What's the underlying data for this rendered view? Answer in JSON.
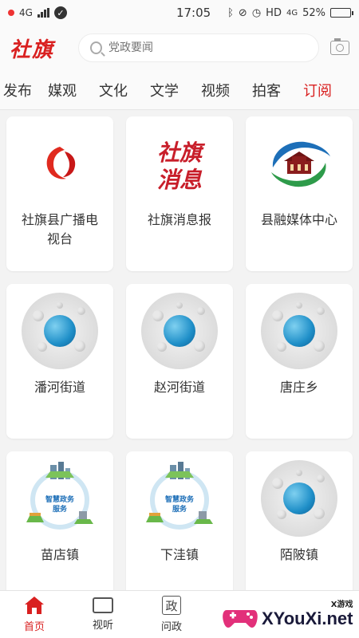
{
  "status_bar": {
    "network": "4G",
    "time": "17:05",
    "network_right": "HD",
    "network_right_type": "4G",
    "battery": "52%",
    "battery_level": 0.52
  },
  "header": {
    "logo_text": "社旗",
    "search_placeholder": "党政要闻",
    "camera_icon": "camera-icon",
    "brand_color": "#d92020"
  },
  "tabs": [
    {
      "label": "发布",
      "active": false
    },
    {
      "label": "媒观",
      "active": false
    },
    {
      "label": "文化",
      "active": false
    },
    {
      "label": "文学",
      "active": false
    },
    {
      "label": "视频",
      "active": false
    },
    {
      "label": "拍客",
      "active": false
    },
    {
      "label": "订阅",
      "active": true
    }
  ],
  "cards": [
    {
      "label": "社旗县广播电视台",
      "icon": "radio-tv-logo"
    },
    {
      "label": "社旗消息报",
      "icon": "news-logo",
      "logo_line1": "社旗",
      "logo_line2": "消息"
    },
    {
      "label": "县融媒体中心",
      "icon": "media-center-logo"
    },
    {
      "label": "潘河街道",
      "icon": "globe-icon"
    },
    {
      "label": "赵河街道",
      "icon": "globe-icon"
    },
    {
      "label": "唐庄乡",
      "icon": "globe-icon"
    },
    {
      "label": "苗店镇",
      "icon": "smart-gov-icon",
      "logo_text": "智慧政务服务"
    },
    {
      "label": "下洼镇",
      "icon": "smart-gov-icon",
      "logo_text": "智慧政务服务"
    },
    {
      "label": "陌陂镇",
      "icon": "globe-icon"
    }
  ],
  "bottom_nav": [
    {
      "label": "首页",
      "icon": "home-icon",
      "active": true
    },
    {
      "label": "视听",
      "icon": "tv-icon",
      "active": false
    },
    {
      "label": "问政",
      "icon": "zheng-icon",
      "glyph": "政",
      "active": false
    }
  ],
  "watermark": {
    "tag": "X游戏",
    "text": "XYouXi.net"
  }
}
